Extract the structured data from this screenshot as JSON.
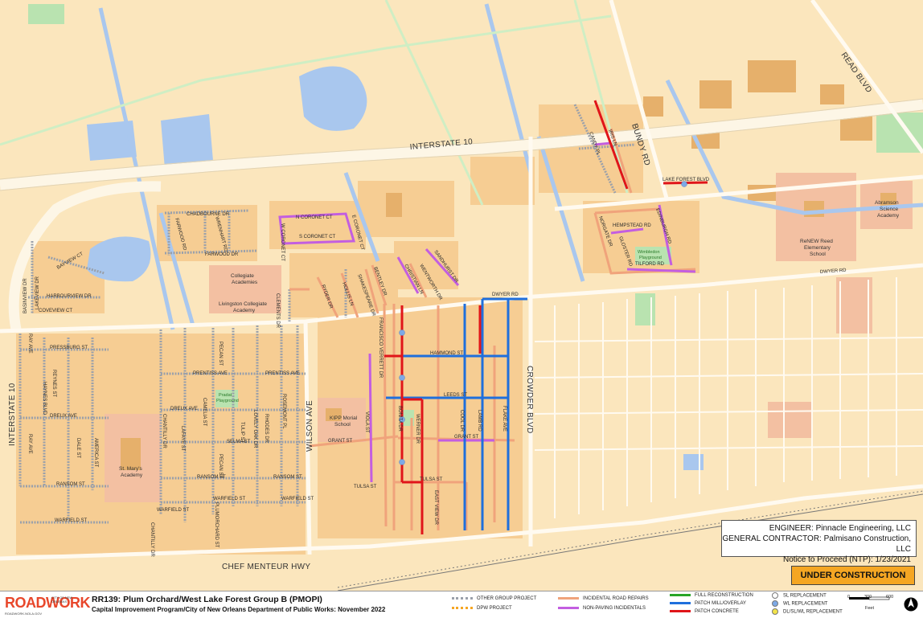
{
  "map": {
    "labels": {
      "interstate_10_top": "INTERSTATE 10",
      "interstate_10_left": "INTERSTATE 10",
      "read_blvd": "READ BLVD",
      "bundy_rd": "BUNDY RD",
      "lake_forest_blvd": "LAKE FOREST BLVD",
      "dwyer_rd_right": "DWYER RD",
      "dwyer_rd": "DWYER RD",
      "crowder_blvd": "CROWDER BLVD",
      "wilson_ave": "WILSON AVE",
      "chef_menteur_hwy": "CHEF MENTEUR HWY",
      "chadbourne_dr": "CHADBOURNE DR",
      "n_coronet_ct": "N CORONET CT",
      "s_coronet_ct": "S CORONET CT",
      "w_coronet_ct": "W CORONET CT",
      "e_coronet_ct": "E CORONET CT",
      "farwood_dr": "FARWOOD DR",
      "hempstead_rd": "HEMPSTEAD RD",
      "tilford_rd": "TILFORD RD",
      "hammond_st": "HAMMOND ST",
      "leeds_st": "LEEDS ST",
      "grant_st": "GRANT ST",
      "grant_st_left": "GRANT ST",
      "tulsa_st": "TULSA ST",
      "tulsa_st_left": "TULSA ST",
      "pressburg_st": "PRESSBURG ST",
      "prentiss_ave": "PRENTISS AVE",
      "prentiss_ave_2": "PRENTISS AVE",
      "dreux_ave": "DREUX AVE",
      "dreux_ave_2": "DREUX AVE",
      "selma_st": "SELMA ST",
      "ransom_st": "RANSOM ST",
      "ransom_st_2": "RANSOM ST",
      "ransom_st_3": "RANSOM ST",
      "warfield_st": "WARFIELD ST",
      "warfield_st_2": "WARFIELD ST",
      "warfield_st_3": "WARFIELD ST",
      "warfield_st_4": "WARFIELD ST",
      "harbourview_dr": "HARBOURVIEW DR",
      "coveview_ct": "COVEVIEW CT",
      "bayview_ct": "BAYVIEW CT",
      "basinview_dr": "BASINVIEW DR",
      "dwyer_rd_mid": "DWYER RD",
      "christian_ln": "CHRISTIAN LN",
      "sandhurst_dr": "SANDHURST DR",
      "wentworth_dr": "WENTWORTH DR",
      "bentley_dr": "BENTLEY DR",
      "shakespeare_dr": "SHAKESPEARE DR",
      "hollis_ln": "HOLLIS LN",
      "ryder_dr": "RYDER DR",
      "clements_dr": "CLEMENTS DR",
      "francisco_verrett_dr": "FRANCISCO VERRETT DR",
      "viola_st": "VIOLA ST",
      "bonita_dr": "BONITA DR",
      "werner_dr": "WERNER DR",
      "east_view_dr": "EAST VIEW DR",
      "cool_dr": "COOL DR",
      "lamb_rd": "LAMB RD",
      "flake_ave": "FLAKE AVE",
      "ray_ave": "RAY AVE",
      "ray_ave_2": "RAY AVE",
      "reynes_st": "REYNES ST",
      "haynes_blvd": "HAYNES BLVD",
      "dale_st": "DALE ST",
      "america_st": "AMERICA ST",
      "chantilly_dr": "CHANTILLY DR",
      "chantilly_dr_2": "CHANTILLY DR",
      "lafaye_st": "LAFAYE ST",
      "camelia_st": "CAMELIA ST",
      "pecan_st": "PECAN ST",
      "pecan_st_2": "PECAN ST",
      "tulip_st": "TULIP ST",
      "lovely_oak_dr": "LOVELY OAK DR",
      "rhodes_dr": "RHODES DR",
      "rosemont_pl": "ROSEMONT PL",
      "plumorchard_st": "PLUMORCHARD ST",
      "norgate_dr": "NORGATE DR",
      "gloster_rd": "GLOSTER RD",
      "edinburgh_rd": "EDINBURGH RD",
      "iris_ln": "IRIS LN",
      "candy_pl": "CANDY PL",
      "harwood_rd": "FARWOOD RD",
      "wrenhart_rd": "WRENHART RD",
      "lake_verret_dr": "LAKE VERRET DR",
      "lakeview_dr": "LAKEVIEW DR"
    },
    "places": {
      "collegiate_academies": "Collegiate Academies",
      "livingston_collegiate": "Livingston Collegiate Academy",
      "kipp_morial": "KIPP Morial School",
      "st_marys": "St. Mary's Academy",
      "renew_reed": "ReNEW Reed Elementary School",
      "abramson": "Abramson Science Academy",
      "wimbledon_playground": "Wimbledon Playground",
      "pradat_playground": "Pradat Playground"
    }
  },
  "info": {
    "engineer": "ENGINEER: Pinnacle Engineering, LLC",
    "contractor": "GENERAL CONTRACTOR: Palmisano Construction, LLC",
    "ntp": "Notice to Proceed (NTP): 1/23/2021"
  },
  "status": "UNDER CONSTRUCTION",
  "footer": {
    "logo_word": "ROADWORK",
    "logo_org": "CITY OF NEW ORLEANS",
    "logo_url": "ROADWORK.NOLA.GOV",
    "project_title": "RR139: Plum Orchard/West Lake Forest Group B (PMOPI)",
    "project_subtitle": "Capital Improvement Program/City of New Orleans Department of Public Works: November 2022"
  },
  "legend": {
    "other_group": "OTHER GROUP PROJECT",
    "dpw_project": "DPW PROJECT",
    "incidental_repairs": "INCIDENTAL ROAD REPAIRS",
    "non_paving": "NON-PAVING INCIDENTALS",
    "full_reconstruction": "FULL RECONSTRUCTION",
    "patch_mill": "PATCH MILL/OVERLAY",
    "patch_concrete": "PATCH CONCRETE",
    "sl_replacement": "SL REPLACEMENT",
    "wl_replacement": "WL REPLACEMENT",
    "dl_replacement": "DL/SL/WL REPLACEMENT"
  },
  "scale": {
    "t0": "0",
    "t1": "300",
    "t2": "600",
    "unit": "Feet"
  },
  "colors": {
    "land": "#fbe6bd",
    "block": "#f6cd93",
    "building": "#e6b06b",
    "water": "#a9c7ee",
    "highway": "#fdf6e6",
    "institution": "#f3c0a2",
    "full_reconstruction": "#27a527",
    "patch_mill": "#1f6fdc",
    "patch_concrete": "#e0151a",
    "incidental": "#f0a37b",
    "non_paving": "#c35ee0",
    "other_group": "#9aa0aa",
    "dpw": "#f5a623",
    "status_badge": "#f5a623"
  }
}
